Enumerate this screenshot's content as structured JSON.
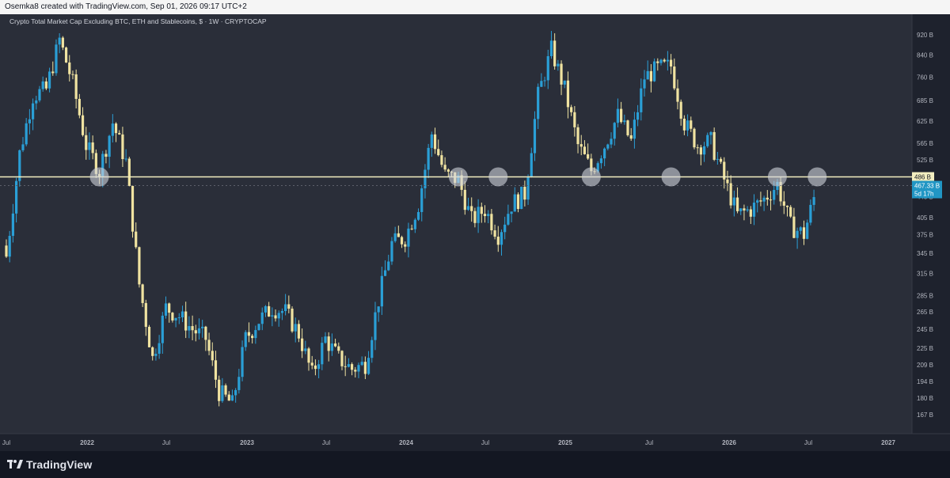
{
  "header": {
    "credit": "Osemka8 created with TradingView.com, Sep 01, 2026 09:17 UTC+2"
  },
  "footer": {
    "brand": "TradingView",
    "logo_icon": "tradingview-logo-icon"
  },
  "colors": {
    "background": "#2a2e39",
    "axis_background": "#1e222d",
    "up_candle": "#2a9fd6",
    "down_candle": "#f0e3a1",
    "horizontal_line": "#f2eec0",
    "price_label": "#2196c4",
    "marker": "#d1d4dc"
  },
  "chart_data": {
    "type": "candlestick",
    "title": "Crypto Total Market Cap Excluding BTC, ETH and Stablecoins, $ · 1W · CRYPTOCAP",
    "x_axis_labels": [
      "Jul",
      "2022",
      "Jul",
      "2023",
      "Jul",
      "2024",
      "Jul",
      "2025",
      "Jul",
      "2026",
      "Jul",
      "2027"
    ],
    "y_tick_labels": [
      "920 B",
      "840 B",
      "760 B",
      "685 B",
      "625 B",
      "565 B",
      "525 B",
      "486 B",
      "445 B",
      "405 B",
      "375 B",
      "345 B",
      "315 B",
      "285 B",
      "265 B",
      "245 B",
      "225 B",
      "209 B",
      "194 B",
      "180 B",
      "167 B"
    ],
    "y_scale": "log",
    "horizontal_line": {
      "value": 486,
      "label": "486 B"
    },
    "current_price": {
      "value": 467.33,
      "label": "467.33 B",
      "countdown": "5d 17h"
    },
    "touch_markers": [
      "2022-02",
      "2024-05",
      "2024-08",
      "2025-03",
      "2025-09",
      "2026-05",
      "2026-08"
    ],
    "weekly_closes": [
      {
        "date": "2021-07",
        "value": 340
      },
      {
        "date": "2021-08",
        "value": 540
      },
      {
        "date": "2021-09",
        "value": 700
      },
      {
        "date": "2021-10",
        "value": 720
      },
      {
        "date": "2021-11",
        "value": 900
      },
      {
        "date": "2021-12",
        "value": 740
      },
      {
        "date": "2022-01",
        "value": 560
      },
      {
        "date": "2022-02",
        "value": 500
      },
      {
        "date": "2022-03",
        "value": 620
      },
      {
        "date": "2022-04",
        "value": 520
      },
      {
        "date": "2022-05",
        "value": 300
      },
      {
        "date": "2022-06",
        "value": 215
      },
      {
        "date": "2022-07",
        "value": 270
      },
      {
        "date": "2022-08",
        "value": 260
      },
      {
        "date": "2022-09",
        "value": 245
      },
      {
        "date": "2022-10",
        "value": 235
      },
      {
        "date": "2022-11",
        "value": 185
      },
      {
        "date": "2022-12",
        "value": 175
      },
      {
        "date": "2023-01",
        "value": 235
      },
      {
        "date": "2023-02",
        "value": 255
      },
      {
        "date": "2023-03",
        "value": 270
      },
      {
        "date": "2023-04",
        "value": 265
      },
      {
        "date": "2023-05",
        "value": 240
      },
      {
        "date": "2023-06",
        "value": 200
      },
      {
        "date": "2023-07",
        "value": 235
      },
      {
        "date": "2023-08",
        "value": 215
      },
      {
        "date": "2023-09",
        "value": 205
      },
      {
        "date": "2023-10",
        "value": 210
      },
      {
        "date": "2023-11",
        "value": 280
      },
      {
        "date": "2023-12",
        "value": 360
      },
      {
        "date": "2024-01",
        "value": 370
      },
      {
        "date": "2024-02",
        "value": 430
      },
      {
        "date": "2024-03",
        "value": 590
      },
      {
        "date": "2024-04",
        "value": 490
      },
      {
        "date": "2024-05",
        "value": 480
      },
      {
        "date": "2024-06",
        "value": 400
      },
      {
        "date": "2024-07",
        "value": 420
      },
      {
        "date": "2024-08",
        "value": 375
      },
      {
        "date": "2024-09",
        "value": 430
      },
      {
        "date": "2024-10",
        "value": 450
      },
      {
        "date": "2024-11",
        "value": 700
      },
      {
        "date": "2024-12",
        "value": 860
      },
      {
        "date": "2025-01",
        "value": 720
      },
      {
        "date": "2025-02",
        "value": 560
      },
      {
        "date": "2025-03",
        "value": 500
      },
      {
        "date": "2025-04",
        "value": 560
      },
      {
        "date": "2025-05",
        "value": 640
      },
      {
        "date": "2025-06",
        "value": 570
      },
      {
        "date": "2025-07",
        "value": 760
      },
      {
        "date": "2025-08",
        "value": 790
      },
      {
        "date": "2025-09",
        "value": 800
      },
      {
        "date": "2025-10",
        "value": 620
      },
      {
        "date": "2025-11",
        "value": 560
      },
      {
        "date": "2025-12",
        "value": 570
      },
      {
        "date": "2026-01",
        "value": 480
      },
      {
        "date": "2026-02",
        "value": 410
      },
      {
        "date": "2026-03",
        "value": 420
      },
      {
        "date": "2026-04",
        "value": 440
      },
      {
        "date": "2026-05",
        "value": 470
      },
      {
        "date": "2026-06",
        "value": 390
      },
      {
        "date": "2026-07",
        "value": 375
      },
      {
        "date": "2026-08",
        "value": 467
      }
    ]
  }
}
